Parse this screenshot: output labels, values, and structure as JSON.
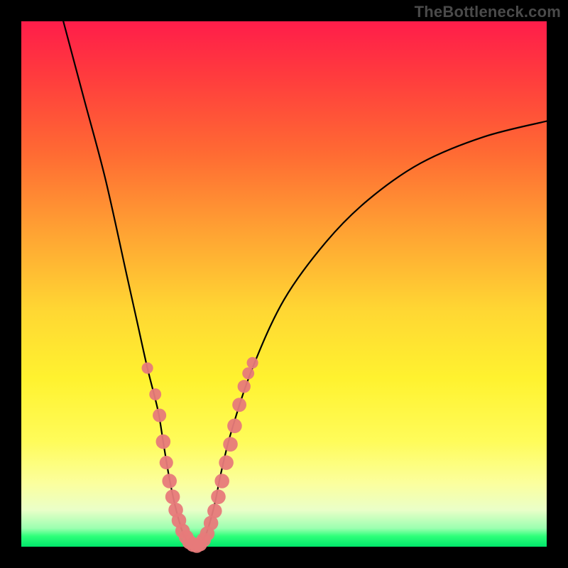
{
  "watermark": "TheBottleneck.com",
  "chart_data": {
    "type": "line",
    "title": "",
    "xlabel": "",
    "ylabel": "",
    "xlim": [
      0,
      100
    ],
    "ylim": [
      0,
      100
    ],
    "grid": false,
    "legend": false,
    "curve": {
      "name": "bottleneck-curve",
      "x": [
        8,
        12,
        16,
        20,
        22,
        24,
        26,
        27,
        28,
        29,
        30,
        31,
        32,
        33,
        34,
        35,
        36,
        37,
        38,
        40,
        44,
        50,
        58,
        66,
        76,
        88,
        100
      ],
      "y": [
        100,
        85,
        70,
        52,
        43,
        34,
        26,
        20,
        14,
        9,
        5,
        2,
        0.5,
        0,
        0.5,
        2,
        5,
        9,
        14,
        22,
        34,
        47,
        58,
        66,
        73,
        78,
        81
      ]
    },
    "markers_left": {
      "name": "left-cluster",
      "color": "#e77a7a",
      "points": [
        {
          "x": 24.0,
          "y": 34.0,
          "r": 1.1
        },
        {
          "x": 25.5,
          "y": 29.0,
          "r": 1.2
        },
        {
          "x": 26.3,
          "y": 25.0,
          "r": 1.5
        },
        {
          "x": 27.0,
          "y": 20.0,
          "r": 1.7
        },
        {
          "x": 27.6,
          "y": 16.0,
          "r": 1.5
        },
        {
          "x": 28.2,
          "y": 12.5,
          "r": 1.7
        },
        {
          "x": 28.8,
          "y": 9.5,
          "r": 1.7
        },
        {
          "x": 29.4,
          "y": 7.0,
          "r": 1.7
        },
        {
          "x": 30.0,
          "y": 5.0,
          "r": 1.7
        },
        {
          "x": 30.7,
          "y": 3.0,
          "r": 1.7
        },
        {
          "x": 31.4,
          "y": 1.8,
          "r": 1.7
        },
        {
          "x": 32.0,
          "y": 0.9,
          "r": 1.7
        },
        {
          "x": 32.7,
          "y": 0.4,
          "r": 1.7
        },
        {
          "x": 33.4,
          "y": 0.2,
          "r": 1.7
        }
      ]
    },
    "markers_right": {
      "name": "right-cluster",
      "color": "#e77a7a",
      "points": [
        {
          "x": 34.0,
          "y": 0.5,
          "r": 1.7
        },
        {
          "x": 34.7,
          "y": 1.3,
          "r": 1.7
        },
        {
          "x": 35.4,
          "y": 2.5,
          "r": 1.7
        },
        {
          "x": 36.1,
          "y": 4.5,
          "r": 1.7
        },
        {
          "x": 36.8,
          "y": 6.8,
          "r": 1.7
        },
        {
          "x": 37.5,
          "y": 9.5,
          "r": 1.7
        },
        {
          "x": 38.2,
          "y": 12.5,
          "r": 1.7
        },
        {
          "x": 39.0,
          "y": 16.0,
          "r": 1.7
        },
        {
          "x": 39.8,
          "y": 19.5,
          "r": 1.7
        },
        {
          "x": 40.6,
          "y": 23.0,
          "r": 1.7
        },
        {
          "x": 41.5,
          "y": 27.0,
          "r": 1.6
        },
        {
          "x": 42.4,
          "y": 30.5,
          "r": 1.4
        },
        {
          "x": 43.2,
          "y": 33.0,
          "r": 1.2
        },
        {
          "x": 44.0,
          "y": 35.0,
          "r": 1.1
        }
      ]
    }
  }
}
